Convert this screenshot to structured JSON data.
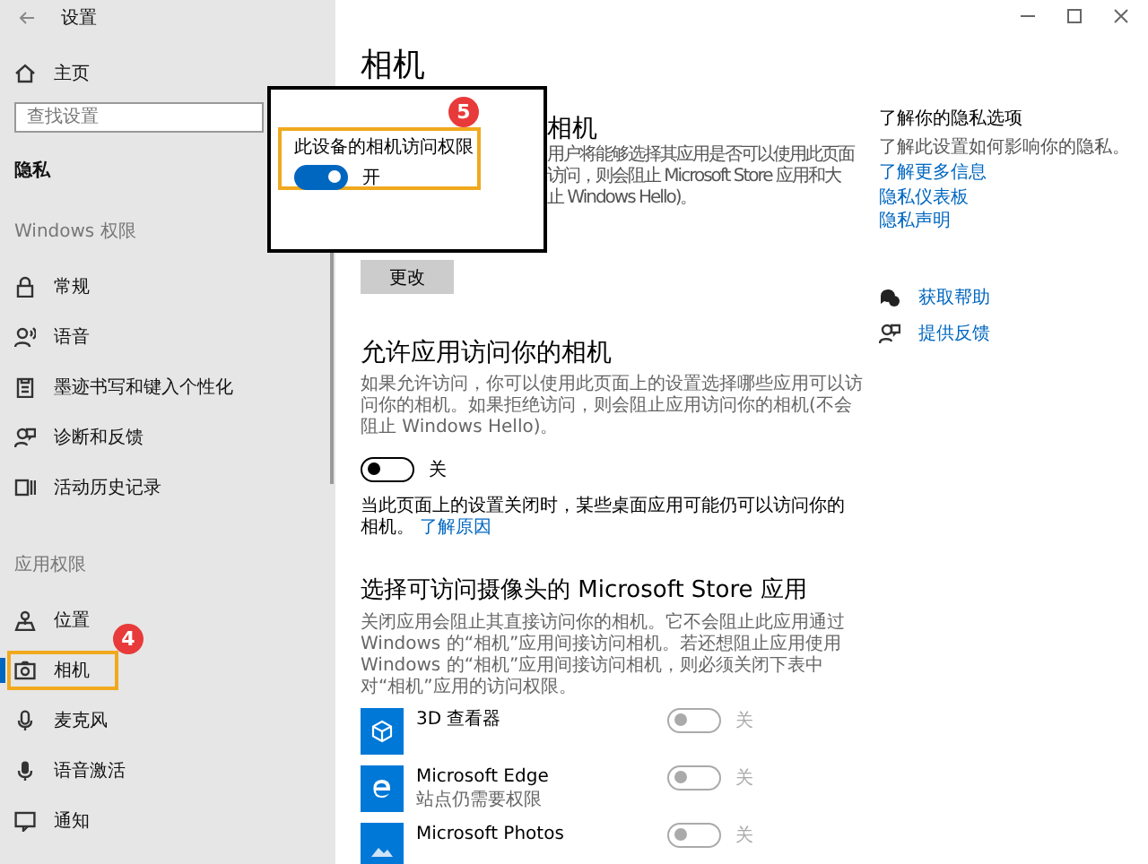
{
  "window": {
    "title": "设置"
  },
  "sidebar": {
    "home": "主页",
    "search": {
      "placeholder": "查找设置"
    },
    "section": "隐私",
    "groups": [
      {
        "heading": "Windows 权限",
        "items": [
          {
            "label": "常规",
            "kind": "lock",
            "selected": false
          },
          {
            "label": "语音",
            "kind": "speech",
            "selected": false
          },
          {
            "label": "墨迹书写和键入个性化",
            "kind": "ink",
            "selected": false
          },
          {
            "label": "诊断和反馈",
            "kind": "feedback",
            "selected": false
          },
          {
            "label": "活动历史记录",
            "kind": "history",
            "selected": false
          }
        ]
      },
      {
        "heading": "应用权限",
        "items": [
          {
            "label": "位置",
            "kind": "location",
            "selected": false
          },
          {
            "label": "相机",
            "kind": "camera",
            "selected": true,
            "highlighted": true,
            "badge": "4"
          },
          {
            "label": "麦克风",
            "kind": "mic",
            "selected": false
          },
          {
            "label": "语音激活",
            "kind": "voice",
            "selected": false
          },
          {
            "label": "通知",
            "kind": "notify",
            "selected": false
          }
        ]
      }
    ]
  },
  "main": {
    "title": "相机",
    "device_section": {
      "heading": "相机",
      "description_lines": [
        "用户将能够选择其应用是否可以使用此页面",
        "访问，则会阻止 Microsoft Store 应用和大",
        "止 Windows Hello)。"
      ],
      "button": "更改"
    },
    "allow_section": {
      "heading": "允许应用访问你的相机",
      "description": "如果允许访问，你可以使用此页面上的设置选择哪些应用可以访问你的相机。如果拒绝访问，则会阻止应用访问你的相机(不会阻止 Windows Hello)。",
      "toggle": {
        "on": false,
        "label": "关"
      },
      "note": "当此页面上的设置关闭时，某些桌面应用可能仍可以访问你的相机。",
      "note_link": "了解原因"
    },
    "apps_section": {
      "heading": "选择可访问摄像头的 Microsoft Store 应用",
      "description": "关闭应用会阻止其直接访问你的相机。它不会阻止此应用通过 Windows 的“相机”应用间接访问相机。若还想阻止应用使用 Windows 的“相机”应用间接访问相机，则必须关闭下表中对“相机”应用的访问权限。",
      "apps": [
        {
          "name": "3D 查看器",
          "kind": "cube",
          "toggle": {
            "on": false,
            "disabled": true,
            "label": "关"
          }
        },
        {
          "name": "Microsoft Edge",
          "subtitle": "站点仍需要权限",
          "kind": "edge",
          "toggle": {
            "on": false,
            "disabled": true,
            "label": "关"
          }
        },
        {
          "name": "Microsoft Photos",
          "kind": "photos",
          "toggle": {
            "on": false,
            "disabled": true,
            "label": "关"
          }
        }
      ]
    }
  },
  "aside": {
    "heading": "了解你的隐私选项",
    "text": "了解此设置如何影响你的隐私。",
    "links": [
      "了解更多信息",
      "隐私仪表板",
      "隐私声明"
    ],
    "help": [
      {
        "label": "获取帮助",
        "kind": "help"
      },
      {
        "label": "提供反馈",
        "kind": "feedback"
      }
    ]
  },
  "popup": {
    "label": "此设备的相机访问权限",
    "toggle": {
      "on": true,
      "label": "开"
    },
    "highlighted": true,
    "badge": "5"
  }
}
